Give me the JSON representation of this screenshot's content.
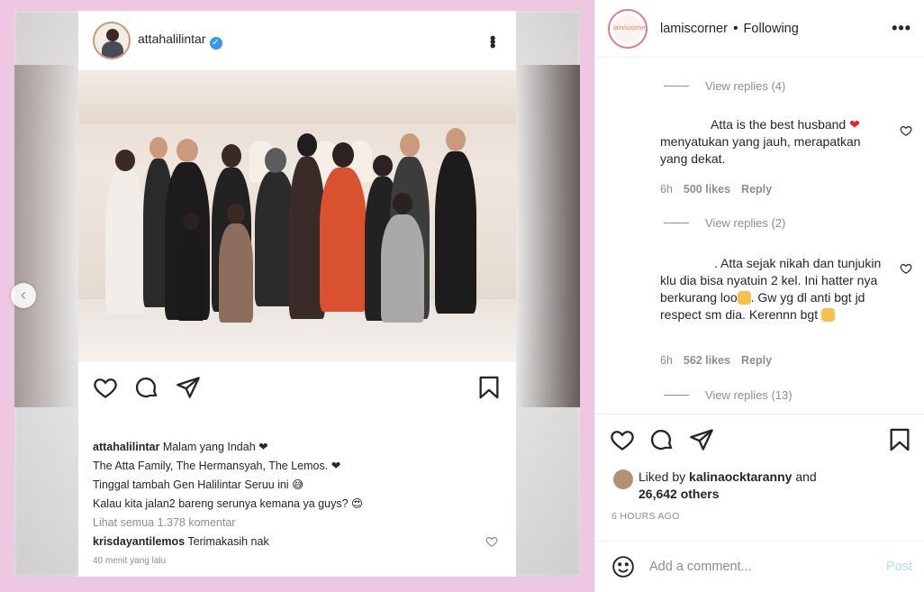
{
  "post_media": {
    "card_username": "attahalilintar",
    "caption_lines": [
      {
        "user": "attahalilintar",
        "text": "Malam yang Indah ❤"
      },
      {
        "text": "The Atta Family, The Hermansyah, The Lemos. ❤"
      },
      {
        "text": "Tinggal tambah Gen Halilintar Seruu ini 😅"
      },
      {
        "text": "Kalau kita jalan2 bareng serunya kemana ya guys? 😍"
      }
    ],
    "view_all": "Lihat semua 1.378 komentar",
    "reply_user": "krisdayantilemos",
    "reply_text": "Terimakasih nak",
    "reply_time": "40 menit yang lalu"
  },
  "header": {
    "avatar_text": "lamiscorner",
    "username": "lamiscorner",
    "separator": "•",
    "follow_status": "Following",
    "more": "•••"
  },
  "comments": {
    "view_replies_1": "View replies (4)",
    "comment_1_line1": "Atta is the best husband",
    "comment_1_rest": "menyatukan yang jauh, merapatkan yang dekat.",
    "comment_1_time": "6h",
    "comment_1_likes": "500 likes",
    "comment_1_reply": "Reply",
    "view_replies_2": "View replies (2)",
    "comment_2_a": ". Atta sejak nikah dan tunjukin klu dia bisa nyatuin 2 kel. Ini hatter nya berkurang loo",
    "comment_2_b": ". Gw yg dl anti bgt jd respect sm dia. Kerennn bgt",
    "comment_2_time": "6h",
    "comment_2_likes": "562 likes",
    "comment_2_reply": "Reply",
    "view_replies_3": "View replies (13)"
  },
  "likes": {
    "liked_by_prefix": "Liked by",
    "liked_by_user": "kalinaocktaranny",
    "liked_by_and": "and",
    "others": "26,642 others"
  },
  "timestamp": "6 HOURS AGO",
  "add_comment": {
    "placeholder": "Add a comment...",
    "post_label": "Post"
  },
  "colors": {
    "frame_pink": "#eec7e3",
    "heart_red": "#ed1c2a",
    "verified_blue": "#3897f0",
    "post_disabled": "#b3dbff"
  }
}
